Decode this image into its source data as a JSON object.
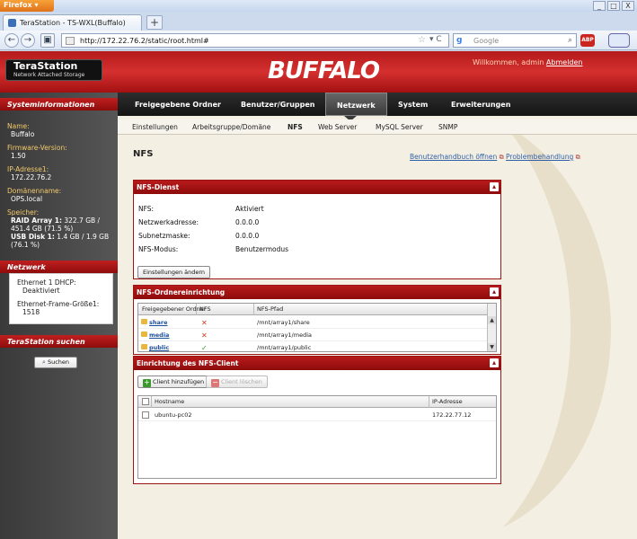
{
  "browser": {
    "app_button": "Firefox",
    "tab_title": "TeraStation - TS-WXL(Buffalo)",
    "new_tab": "+",
    "url": "http://172.22.76.2/static/root.html#",
    "search_placeholder": "Google",
    "window_min": "_",
    "window_max": "□",
    "window_close": "X"
  },
  "header": {
    "product_name": "TeraStation",
    "product_sub": "Network Attached Storage",
    "brand": "BUFFALO",
    "welcome_text": "Willkommen, admin",
    "logout_link": "Abmelden"
  },
  "sidebar": {
    "sysinfo_title": "Systeminformationen",
    "name_label": "Name:",
    "name_value": "Buffalo",
    "fw_label": "Firmware-Version:",
    "fw_value": "1.50",
    "ip_label": "IP-Adresse1:",
    "ip_value": "172.22.76.2",
    "domain_label": "Domänenname:",
    "domain_value": "OPS.local",
    "storage_label": "Speicher:",
    "raid_name": "RAID Array 1:",
    "raid_value": "322.7 GB / 451.4 GB (71.5 %)",
    "usb_name": "USB Disk 1:",
    "usb_value": "1.4 GB / 1.9 GB (76.1 %)",
    "network_title": "Netzwerk",
    "eth_dhcp": "Ethernet 1 DHCP:",
    "eth_dhcp_value": "Deaktiviert",
    "eth_frame": "Ethernet-Frame-Größe1:",
    "eth_frame_value": "1518",
    "search_title": "TeraStation suchen",
    "search_button": "Suchen"
  },
  "mainnav": [
    "Freigegebene Ordner",
    "Benutzer/Gruppen",
    "Netzwerk",
    "System",
    "Erweiterungen"
  ],
  "subnav": [
    "Einstellungen",
    "Arbeitsgruppe/Domäne",
    "NFS",
    "Web Server",
    "MySQL Server",
    "SNMP"
  ],
  "content": {
    "title": "NFS",
    "link_manual": "Benutzerhandbuch öffnen",
    "link_trouble": "Problembehandlung"
  },
  "nfs_service": {
    "title": "NFS-Dienst",
    "rows": [
      {
        "label": "NFS:",
        "value": "Aktiviert"
      },
      {
        "label": "Netzwerkadresse:",
        "value": "0.0.0.0"
      },
      {
        "label": "Subnetzmaske:",
        "value": "0.0.0.0"
      },
      {
        "label": "NFS-Modus:",
        "value": "Benutzermodus"
      }
    ],
    "button": "Einstellungen ändern"
  },
  "nfs_folders": {
    "title": "NFS-Ordnereinrichtung",
    "columns": [
      "Freigegebener Ordner",
      "NFS",
      "NFS-Pfad"
    ],
    "rows": [
      {
        "name": "share",
        "nfs": "✕",
        "path": "/mnt/array1/share"
      },
      {
        "name": "media",
        "nfs": "✕",
        "path": "/mnt/array1/media"
      },
      {
        "name": "public",
        "nfs": "✓",
        "path": "/mnt/array1/public"
      }
    ]
  },
  "nfs_client": {
    "title": "Einrichtung des NFS-Client",
    "add_button": "Client hinzufügen",
    "delete_button": "Client löschen",
    "columns": [
      "Hostname",
      "IP-Adresse"
    ],
    "rows": [
      {
        "host": "ubuntu-pc02",
        "ip": "172.22.77.12"
      }
    ]
  },
  "colors": {
    "brand_red": "#b41a1a",
    "sidebar_label": "#f3c96b",
    "link_blue": "#2f5fa7"
  }
}
